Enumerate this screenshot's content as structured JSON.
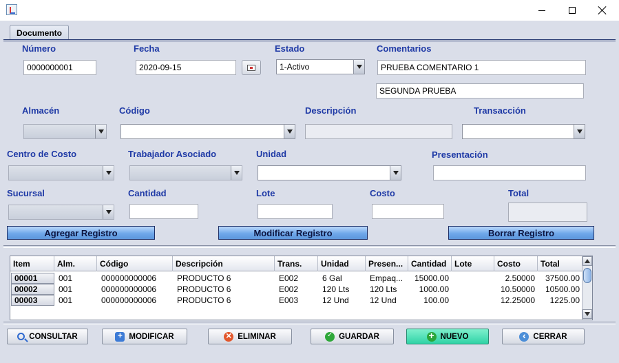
{
  "window": {
    "icon": "java-cup-icon",
    "controls": {
      "minimize": "minimize-icon",
      "maximize": "maximize-icon",
      "close": "close-icon"
    }
  },
  "tab": {
    "label": "Documento"
  },
  "form": {
    "numero": {
      "label": "Número",
      "value": "0000000001"
    },
    "fecha": {
      "label": "Fecha",
      "value": "2020-09-15"
    },
    "estado": {
      "label": "Estado",
      "value": "1-Activo"
    },
    "comentarios": {
      "label": "Comentarios",
      "value1": "PRUEBA COMENTARIO 1",
      "value2": "SEGUNDA PRUEBA"
    },
    "almacen": {
      "label": "Almacén",
      "value": ""
    },
    "codigo": {
      "label": "Código",
      "value": ""
    },
    "descripcion": {
      "label": "Descripción",
      "value": ""
    },
    "transaccion": {
      "label": "Transacción",
      "value": ""
    },
    "centro_costo": {
      "label": "Centro de Costo",
      "value": ""
    },
    "trabajador": {
      "label": "Trabajador Asociado",
      "value": ""
    },
    "unidad": {
      "label": "Unidad",
      "value": ""
    },
    "presentacion": {
      "label": "Presentación",
      "value": ""
    },
    "sucursal": {
      "label": "Sucursal",
      "value": ""
    },
    "cantidad": {
      "label": "Cantidad",
      "value": ""
    },
    "lote": {
      "label": "Lote",
      "value": ""
    },
    "costo": {
      "label": "Costo",
      "value": ""
    },
    "total": {
      "label": "Total",
      "value": ""
    }
  },
  "actions": {
    "agregar": "Agregar Registro",
    "modificar": "Modificar Registro",
    "borrar": "Borrar Registro"
  },
  "table": {
    "headers": [
      "Item",
      "Alm.",
      "Código",
      "Descripción",
      "Trans.",
      "Unidad",
      "Presen...",
      "Cantidad",
      "Lote",
      "Costo",
      "Total"
    ],
    "rows": [
      [
        "00001",
        "001",
        "000000000006",
        "PRODUCTO 6",
        "E002",
        "6 Gal",
        "Empaq...",
        "15000.00",
        "",
        "2.50000",
        "37500.00"
      ],
      [
        "00002",
        "001",
        "000000000006",
        "PRODUCTO 6",
        "E002",
        "120 Lts",
        "120 Lts",
        "1000.00",
        "",
        "10.50000",
        "10500.00"
      ],
      [
        "00003",
        "001",
        "000000000006",
        "PRODUCTO 6",
        "E003",
        "12 Und",
        "12 Und",
        "100.00",
        "",
        "12.25000",
        "1225.00"
      ]
    ]
  },
  "toolbar": {
    "consultar": "CONSULTAR",
    "modificar": "MODIFICAR",
    "eliminar": "ELIMINAR",
    "guardar": "GUARDAR",
    "nuevo": "NUEVO",
    "cerrar": "CERRAR"
  },
  "colors": {
    "label": "#1f3aa6",
    "client_bg": "#dadee9",
    "action_button": "#6fa8ea",
    "nuevo_button": "#2fd3a6"
  }
}
